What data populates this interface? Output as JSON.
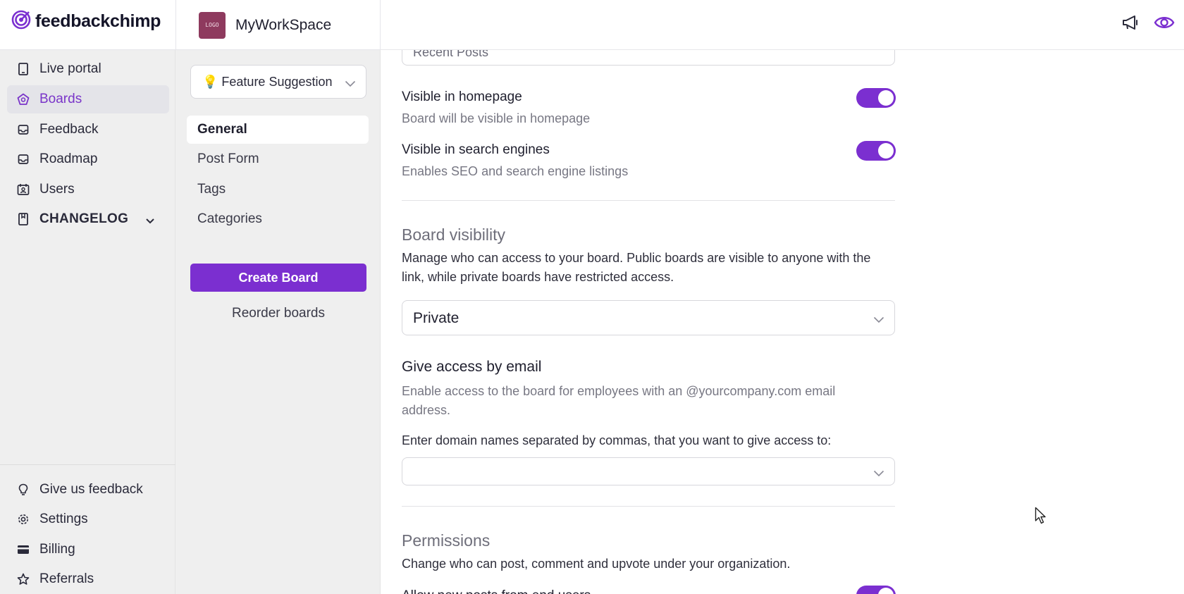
{
  "app": {
    "brand": "feedbackchimp",
    "accent": "#7b2fd0"
  },
  "workspace": {
    "logo_text": "LOGO",
    "name": "MyWorkSpace"
  },
  "topbar": {
    "icons": [
      "megaphone-icon",
      "eye-icon"
    ]
  },
  "sidebar": {
    "items": [
      {
        "label": "Live portal",
        "icon": "tablet-icon"
      },
      {
        "label": "Boards",
        "icon": "boards-icon",
        "active": true
      },
      {
        "label": "Feedback",
        "icon": "inbox-icon"
      },
      {
        "label": "Roadmap",
        "icon": "inbox-icon"
      },
      {
        "label": "Users",
        "icon": "users-calendar-icon"
      },
      {
        "label": "CHANGELOG",
        "icon": "bookmark-icon"
      }
    ],
    "bottom_items": [
      {
        "label": "Give us feedback",
        "icon": "lightbulb-icon"
      },
      {
        "label": "Settings",
        "icon": "gear-icon"
      },
      {
        "label": "Billing",
        "icon": "credit-card-icon"
      },
      {
        "label": "Referrals",
        "icon": "star-icon"
      }
    ]
  },
  "boards_panel": {
    "board_select": "💡 Feature Suggestion",
    "tabs": [
      {
        "label": "General",
        "active": true
      },
      {
        "label": "Post Form"
      },
      {
        "label": "Tags"
      },
      {
        "label": "Categories"
      }
    ],
    "create_button": "Create Board",
    "reorder_link": "Reorder boards"
  },
  "main": {
    "default_view_select": "Recent Posts",
    "visible_homepage": {
      "title": "Visible in homepage",
      "desc": "Board will be visible in homepage",
      "enabled": true
    },
    "visible_search": {
      "title": "Visible in search engines",
      "desc": "Enables SEO and search engine listings",
      "enabled": true
    },
    "board_visibility": {
      "title": "Board visibility",
      "desc": "Manage who can access to your board. Public boards are visible to anyone with the link, while private boards have restricted access.",
      "value": "Private"
    },
    "email_access": {
      "title": "Give access by email",
      "desc": "Enable access to the board for employees with an @yourcompany.com email address.",
      "domain_label": "Enter domain names separated by commas, that you want to give access to:",
      "domain_value": ""
    },
    "permissions": {
      "title": "Permissions",
      "desc": "Change who can post, comment and upvote under your organization.",
      "first_option": "Allow new posts from end users",
      "first_enabled": true
    }
  }
}
